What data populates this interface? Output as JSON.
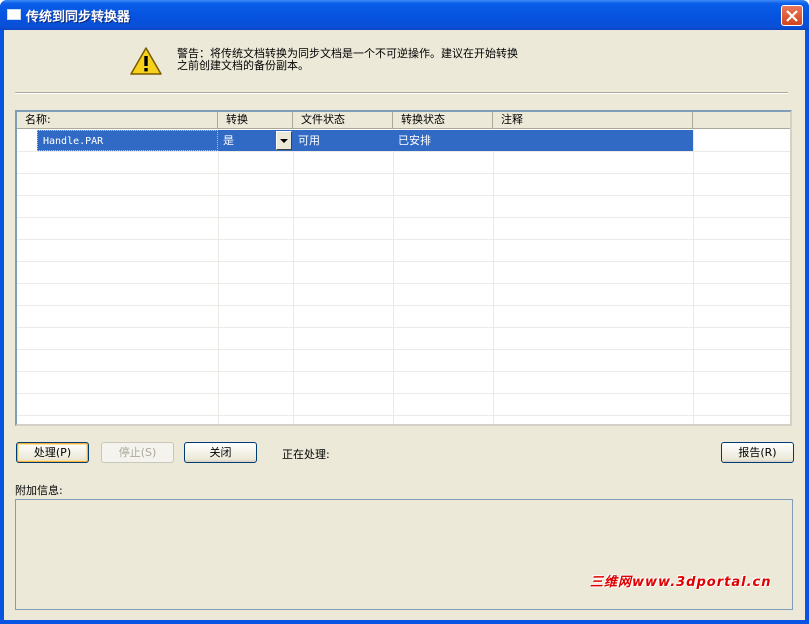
{
  "window": {
    "title": "传统到同步转换器"
  },
  "warning": {
    "text_line1": "警告：将传统文档转换为同步文档是一个不可逆操作。建议在开始转换",
    "text_line2": "之前创建文档的备份副本。"
  },
  "table": {
    "columns": [
      "名称:",
      "转换",
      "文件状态",
      "转换状态",
      "注释"
    ],
    "rows": [
      {
        "name": "Handle.PAR",
        "convert": "是",
        "file_status": "可用",
        "convert_status": "已安排",
        "note": ""
      }
    ]
  },
  "buttons": {
    "process": "处理(P)",
    "stop": "停止(S)",
    "close": "关闭",
    "report": "报告(R)"
  },
  "status": {
    "processing_label": "正在处理:"
  },
  "info": {
    "label": "附加信息:"
  },
  "watermark": "三维网www.3dportal.cn"
}
